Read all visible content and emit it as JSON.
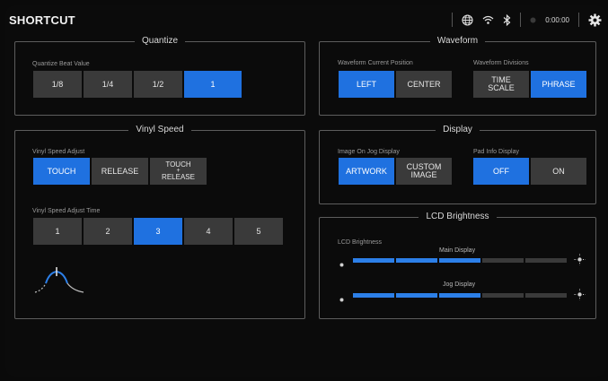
{
  "header": {
    "title": "SHORTCUT",
    "time": "0:00:00"
  },
  "quantize": {
    "title": "Quantize",
    "beat_label": "Quantize Beat Value",
    "options": [
      "1/8",
      "1/4",
      "1/2",
      "1"
    ],
    "selected_index": 3
  },
  "vinyl_speed": {
    "title": "Vinyl Speed",
    "adjust_label": "Vinyl Speed Adjust",
    "adjust_options": [
      {
        "label": "TOUCH",
        "line2": "",
        "line3": ""
      },
      {
        "label": "RELEASE",
        "line2": "",
        "line3": ""
      },
      {
        "label": "TOUCH",
        "line2": "+",
        "line3": "RELEASE"
      }
    ],
    "adjust_selected_index": 0,
    "time_label": "Vinyl Speed Adjust Time",
    "time_options": [
      "1",
      "2",
      "3",
      "4",
      "5"
    ],
    "time_selected_index": 2
  },
  "waveform": {
    "title": "Waveform",
    "position_label": "Waveform Current Position",
    "position_options": [
      "LEFT",
      "CENTER"
    ],
    "position_selected_index": 0,
    "divisions_label": "Waveform Divisions",
    "divisions_options": [
      {
        "line1": "TIME",
        "line2": "SCALE"
      },
      {
        "line1": "PHRASE",
        "line2": ""
      }
    ],
    "divisions_selected_index": 1
  },
  "display": {
    "title": "Display",
    "jog_image_label": "Image On Jog Display",
    "jog_image_options": [
      {
        "line1": "ARTWORK",
        "line2": ""
      },
      {
        "line1": "CUSTOM",
        "line2": "IMAGE"
      }
    ],
    "jog_image_selected_index": 0,
    "pad_info_label": "Pad Info Display",
    "pad_info_options": [
      "OFF",
      "ON"
    ],
    "pad_info_selected_index": 0
  },
  "lcd": {
    "title": "LCD Brightness",
    "label": "LCD Brightness",
    "main_label": "Main Display",
    "main_level": 3,
    "jog_label": "Jog Display",
    "jog_level": 3,
    "total_levels": 5
  },
  "colors": {
    "accent": "#1f71e0",
    "button": "#3a3a3a",
    "background": "#0b0b0b"
  }
}
